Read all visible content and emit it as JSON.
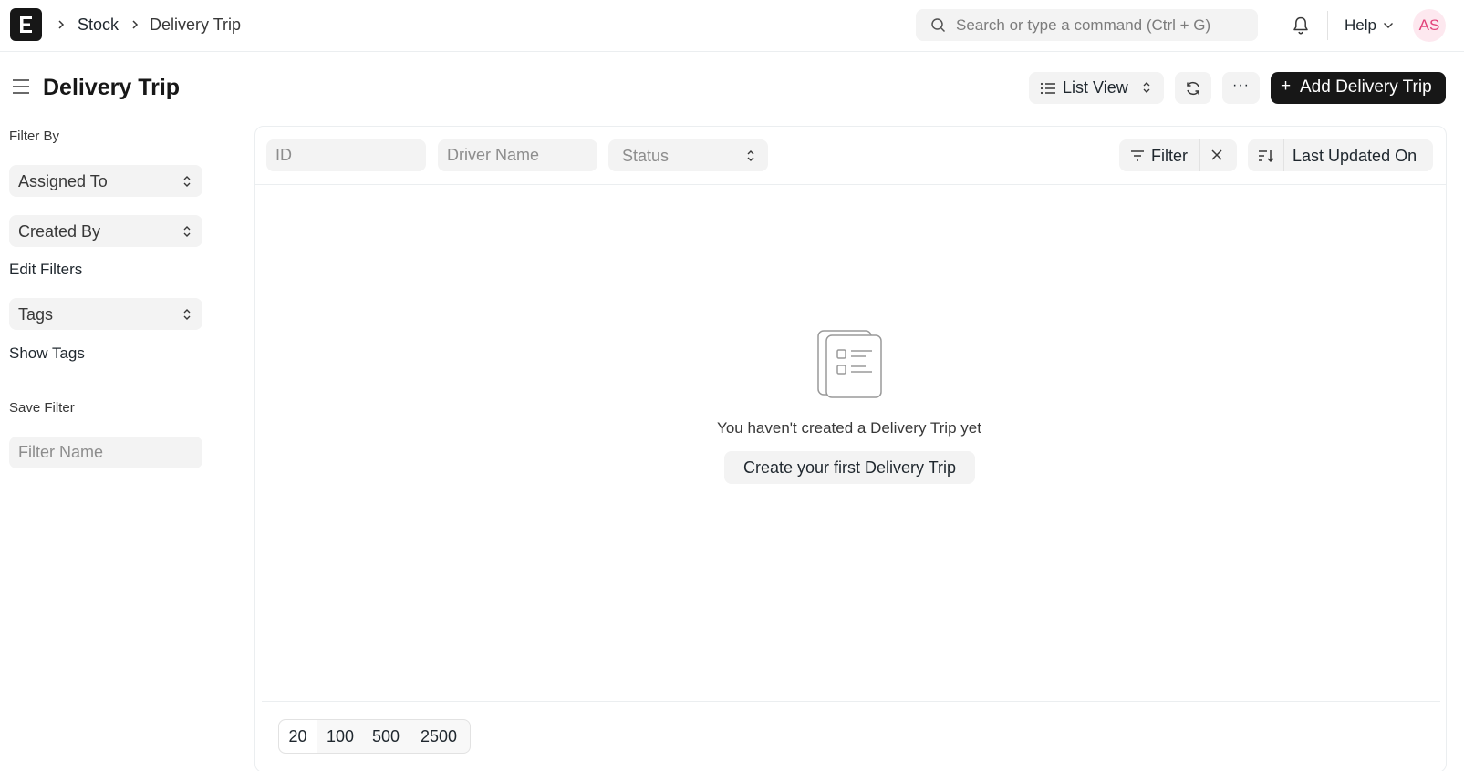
{
  "navbar": {
    "logo_letter": "E",
    "breadcrumbs": [
      "Stock",
      "Delivery Trip"
    ],
    "search_placeholder": "Search or type a command (Ctrl + G)",
    "help_label": "Help",
    "avatar_initials": "AS"
  },
  "page": {
    "title": "Delivery Trip",
    "list_view_label": "List View",
    "more_label": "···",
    "add_button_label": "Add Delivery Trip",
    "add_button_plus": "+"
  },
  "sidebar": {
    "filter_by_label": "Filter By",
    "assigned_to_label": "Assigned To",
    "created_by_label": "Created By",
    "edit_filters_label": "Edit Filters",
    "tags_label": "Tags",
    "show_tags_label": "Show Tags",
    "save_filter_label": "Save Filter",
    "filter_name_placeholder": "Filter Name"
  },
  "list": {
    "id_placeholder": "ID",
    "driver_name_placeholder": "Driver Name",
    "status_placeholder": "Status",
    "filter_label": "Filter",
    "sort_label": "Last Updated On",
    "empty_message": "You haven't created a Delivery Trip yet",
    "empty_cta_label": "Create your first Delivery Trip",
    "page_lengths": [
      "20",
      "100",
      "500",
      "2500"
    ],
    "active_page_length": "20"
  },
  "colors": {
    "primary_button": "#171717",
    "control_bg": "#f3f3f3",
    "avatar_text": "#e2427a",
    "avatar_bg": "#fde8ef"
  }
}
